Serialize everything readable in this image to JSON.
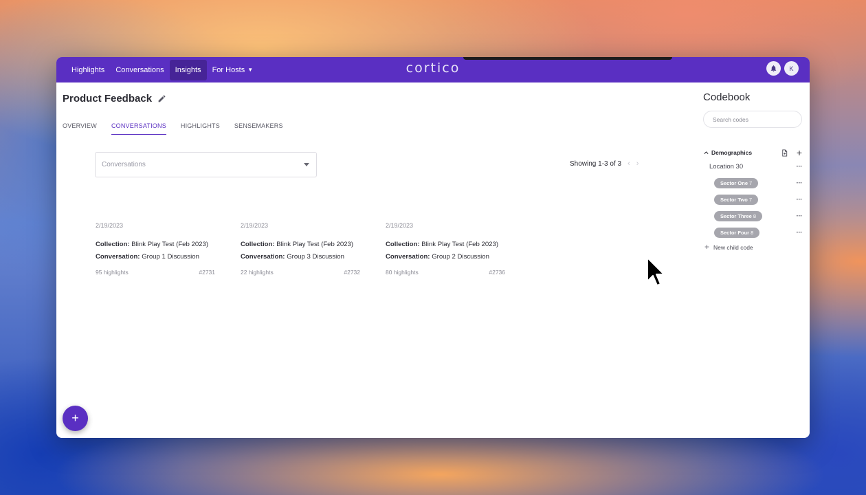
{
  "nav": {
    "links": [
      "Highlights",
      "Conversations",
      "Insights",
      "For Hosts"
    ],
    "active": "Insights",
    "logo": "cortico",
    "avatar_initial": "K"
  },
  "page": {
    "title": "Product Feedback",
    "tabs": [
      "OVERVIEW",
      "CONVERSATIONS",
      "HIGHLIGHTS",
      "SENSEMAKERS"
    ],
    "active_tab": "CONVERSATIONS"
  },
  "filter": {
    "placeholder": "Conversations"
  },
  "pagination": {
    "text": "Showing 1-3 of 3"
  },
  "cards": [
    {
      "date": "2/19/2023",
      "collection_label": "Collection:",
      "collection": "Blink Play Test (Feb 2023)",
      "conversation_label": "Conversation:",
      "conversation": "Group 1 Discussion",
      "highlights": "95 highlights",
      "id": "#2731"
    },
    {
      "date": "2/19/2023",
      "collection_label": "Collection:",
      "collection": "Blink Play Test (Feb 2023)",
      "conversation_label": "Conversation:",
      "conversation": "Group 3 Discussion",
      "highlights": "22 highlights",
      "id": "#2732"
    },
    {
      "date": "2/19/2023",
      "collection_label": "Collection:",
      "collection": "Blink Play Test (Feb 2023)",
      "conversation_label": "Conversation:",
      "conversation": "Group 2 Discussion",
      "highlights": "80 highlights",
      "id": "#2736"
    }
  ],
  "codebook": {
    "title": "Codebook",
    "search_placeholder": "Search codes",
    "group": "Demographics",
    "location": "Location 30",
    "chips": [
      {
        "label": "Sector One",
        "count": "7"
      },
      {
        "label": "Sector Two",
        "count": "7"
      },
      {
        "label": "Sector Three",
        "count": "8"
      },
      {
        "label": "Sector Four",
        "count": "8"
      }
    ],
    "new_child": "New child code"
  },
  "fab": {
    "label": "+"
  },
  "colors": {
    "accent": "#5a2fc2",
    "chip": "#a6a6ad"
  }
}
